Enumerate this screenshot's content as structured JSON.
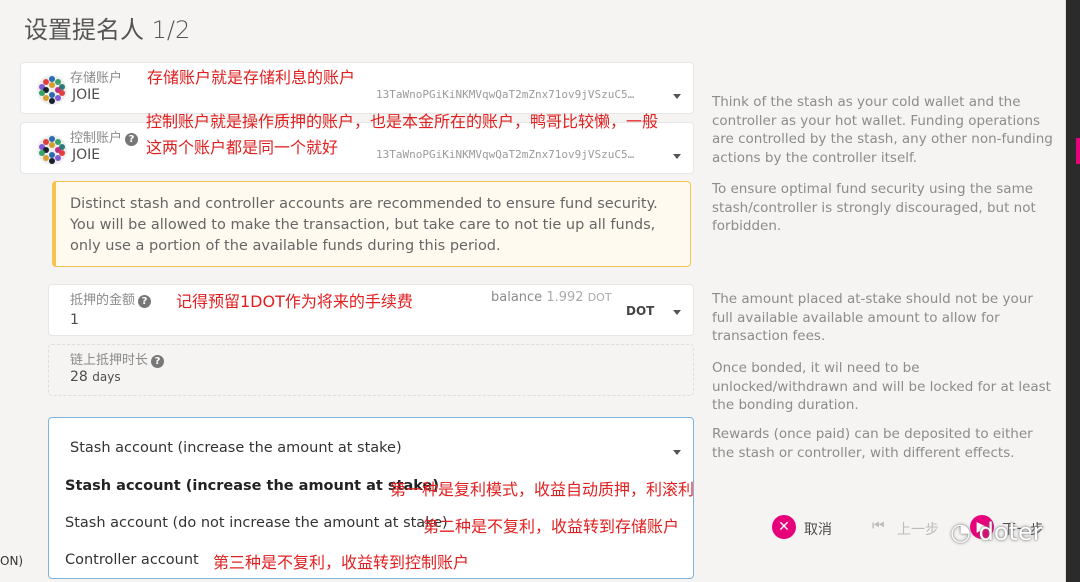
{
  "title": "设置提名人 1/2",
  "stash": {
    "label": "存储账户",
    "name": "JOIE",
    "address": "13TaWnoPGiKiNKMVqwQaT2mZnx71ov9jVSzuC5…",
    "annotation": "存储账户就是存储利息的账户"
  },
  "controller": {
    "label": "控制账户",
    "name": "JOIE",
    "address": "13TaWnoPGiKiNKMVqwQaT2mZnx71ov9jVSzuC5…",
    "annotation_line1": "控制账户就是操作质押的账户，也是本金所在的账户，鸭哥比较懒，一般",
    "annotation_line2": "这两个账户都是同一个就好"
  },
  "help": {
    "stash_controller": "Think of the stash as your cold wallet and the controller as your hot wallet. Funding operations are controlled by the stash, any other non-funding actions by the controller itself.",
    "security": "To ensure optimal fund security using the same stash/controller is strongly discouraged, but not forbidden.",
    "amount": "The amount placed at-stake should not be your full available available amount to allow for transaction fees.",
    "bonded": "Once bonded, it wil need to be unlocked/withdrawn and will be locked for at least the bonding duration.",
    "rewards": "Rewards (once paid) can be deposited to either the stash or controller, with different effects."
  },
  "warning": "Distinct stash and controller accounts are recommended to ensure fund security. You will be allowed to make the transaction, but take care to not tie up all funds, only use a portion of the available funds during this period.",
  "amount": {
    "label": "抵押的金额",
    "value": "1",
    "balance_label": "balance",
    "balance_value": "1.992",
    "balance_unit": "DOT",
    "unit": "DOT",
    "annotation": "记得预留1DOT作为将来的手续费"
  },
  "duration": {
    "label": "链上抵押时长",
    "value": "28",
    "unit": "days"
  },
  "reward": {
    "selected": "Stash account (increase the amount at stake)",
    "options": [
      {
        "label": "Stash account (increase the amount at stake)",
        "annotation": "第一种是复利模式，收益自动质押，利滚利"
      },
      {
        "label": "Stash account (do not increase the amount at stake)",
        "annotation": "第二种是不复利，收益转到存储账户"
      },
      {
        "label": "Controller account",
        "annotation": "第三种是不复利，收益转到控制账户"
      }
    ]
  },
  "buttons": {
    "cancel": "取消",
    "prev": "上一步",
    "next": "下一步"
  },
  "watermark": "doter",
  "edge_text": "ON)"
}
